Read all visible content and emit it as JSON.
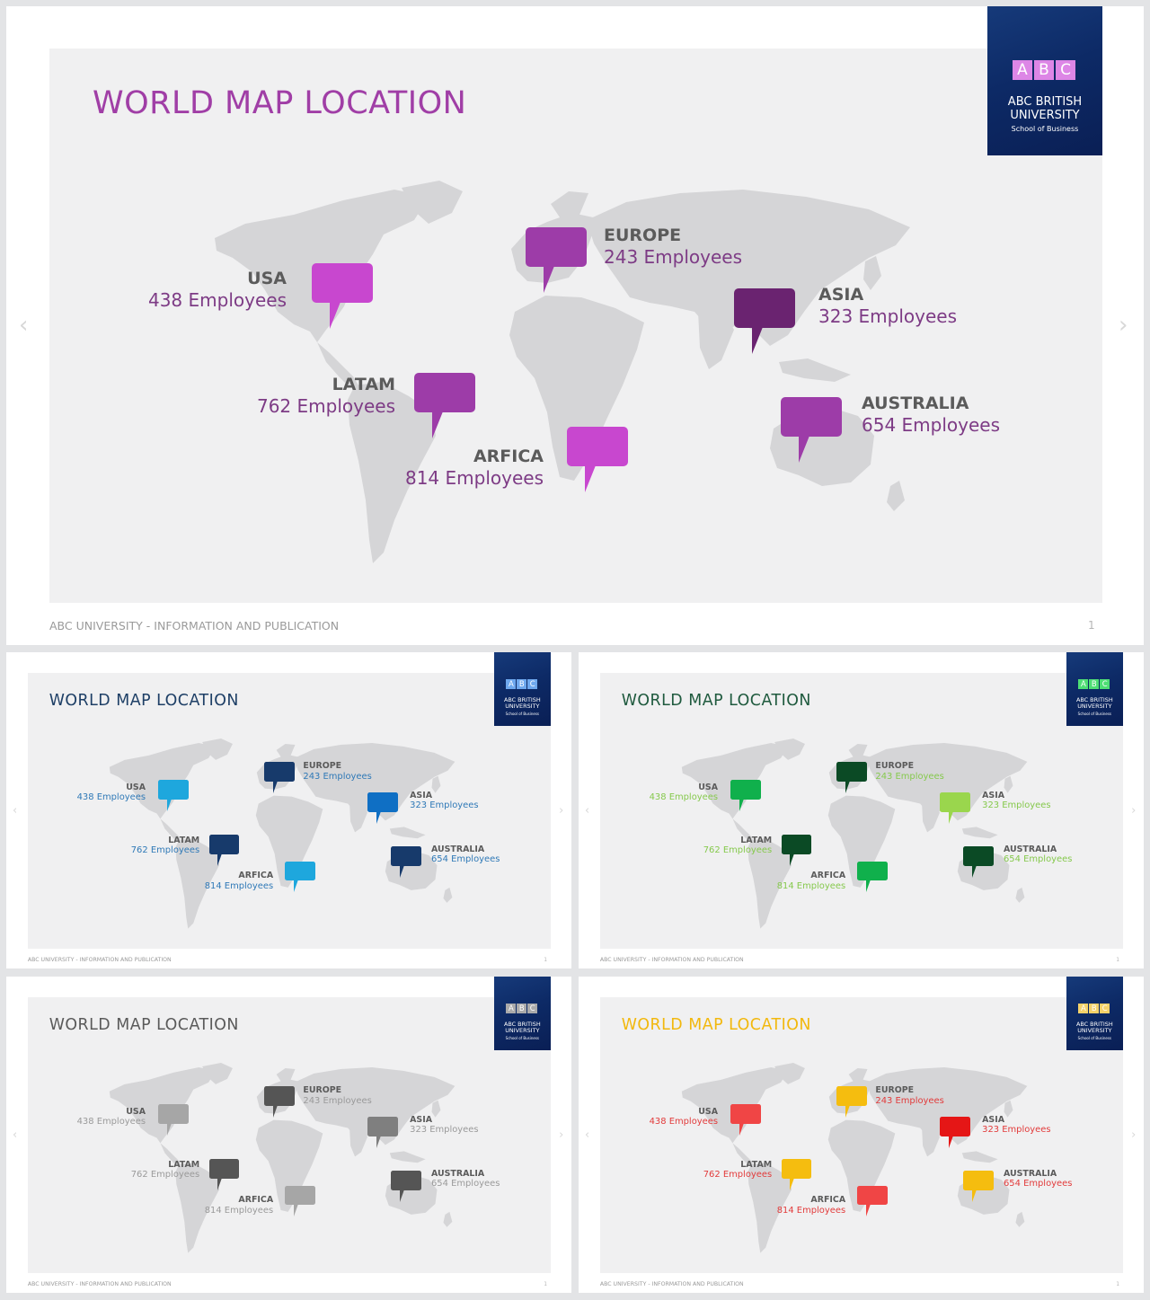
{
  "slides": [
    {
      "title": "WORLD MAP LOCATION",
      "footer": "ABC UNIVERSITY - INFORMATION AND PUBLICATION",
      "page": "1",
      "logo": {
        "letters": [
          "A",
          "B",
          "C"
        ],
        "name": "ABC BRITISH UNIVERSITY",
        "subtitle": "School of Business"
      },
      "colors": {
        "title": "#a03ea6",
        "text": "#7d3b85",
        "pin_light": "#c847cf",
        "pin_mid": "#9d3ca8",
        "pin_dark": "#6a2370",
        "tile": "#dd86e6"
      },
      "regions": [
        {
          "name": "USA",
          "count": "438 Employees",
          "tone": "light"
        },
        {
          "name": "EUROPE",
          "count": "243 Employees",
          "tone": "mid"
        },
        {
          "name": "ASIA",
          "count": "323 Employees",
          "tone": "dark"
        },
        {
          "name": "LATAM",
          "count": "762 Employees",
          "tone": "mid"
        },
        {
          "name": "ARFICA",
          "count": "814 Employees",
          "tone": "light"
        },
        {
          "name": "AUSTRALIA",
          "count": "654 Employees",
          "tone": "mid"
        }
      ]
    },
    {
      "title": "WORLD MAP LOCATION",
      "footer": "ABC UNIVERSITY - INFORMATION AND PUBLICATION",
      "page": "1",
      "logo": {
        "letters": [
          "A",
          "B",
          "C"
        ],
        "name": "ABC BRITISH UNIVERSITY",
        "subtitle": "School of Business"
      },
      "colors": {
        "title": "#1e3f66",
        "text": "#2f79b7",
        "pin_light": "#1ea7dd",
        "pin_mid": "#0f6fc4",
        "pin_dark": "#173a6b",
        "tile": "#6ea8ee"
      },
      "regions": [
        {
          "name": "USA",
          "count": "438 Employees",
          "tone": "light"
        },
        {
          "name": "EUROPE",
          "count": "243 Employees",
          "tone": "dark"
        },
        {
          "name": "ASIA",
          "count": "323 Employees",
          "tone": "mid"
        },
        {
          "name": "LATAM",
          "count": "762 Employees",
          "tone": "dark"
        },
        {
          "name": "ARFICA",
          "count": "814 Employees",
          "tone": "light"
        },
        {
          "name": "AUSTRALIA",
          "count": "654 Employees",
          "tone": "dark"
        }
      ]
    },
    {
      "title": "WORLD MAP LOCATION",
      "footer": "ABC UNIVERSITY - INFORMATION AND PUBLICATION",
      "page": "1",
      "logo": {
        "letters": [
          "A",
          "B",
          "C"
        ],
        "name": "ABC BRITISH UNIVERSITY",
        "subtitle": "School of Business"
      },
      "colors": {
        "title": "#1f5a3e",
        "text": "#86c94d",
        "pin_light": "#9ad64d",
        "pin_mid": "#10b04c",
        "pin_dark": "#0b4a25",
        "tile": "#4ede74"
      },
      "regions": [
        {
          "name": "USA",
          "count": "438 Employees",
          "tone": "mid"
        },
        {
          "name": "EUROPE",
          "count": "243 Employees",
          "tone": "dark"
        },
        {
          "name": "ASIA",
          "count": "323 Employees",
          "tone": "light"
        },
        {
          "name": "LATAM",
          "count": "762 Employees",
          "tone": "dark"
        },
        {
          "name": "ARFICA",
          "count": "814 Employees",
          "tone": "mid"
        },
        {
          "name": "AUSTRALIA",
          "count": "654 Employees",
          "tone": "dark"
        }
      ]
    },
    {
      "title": "WORLD MAP LOCATION",
      "footer": "ABC UNIVERSITY - INFORMATION AND PUBLICATION",
      "page": "1",
      "logo": {
        "letters": [
          "A",
          "B",
          "C"
        ],
        "name": "ABC BRITISH UNIVERSITY",
        "subtitle": "School of Business"
      },
      "colors": {
        "title": "#5a5a5a",
        "text": "#9a9a9a",
        "pin_light": "#a6a6a6",
        "pin_mid": "#7f7f7f",
        "pin_dark": "#555555",
        "tile": "#aaaaaa"
      },
      "regions": [
        {
          "name": "USA",
          "count": "438 Employees",
          "tone": "light"
        },
        {
          "name": "EUROPE",
          "count": "243 Employees",
          "tone": "dark"
        },
        {
          "name": "ASIA",
          "count": "323 Employees",
          "tone": "mid"
        },
        {
          "name": "LATAM",
          "count": "762 Employees",
          "tone": "dark"
        },
        {
          "name": "ARFICA",
          "count": "814 Employees",
          "tone": "light"
        },
        {
          "name": "AUSTRALIA",
          "count": "654 Employees",
          "tone": "dark"
        }
      ]
    },
    {
      "title": "WORLD MAP LOCATION",
      "footer": "ABC UNIVERSITY - INFORMATION AND PUBLICATION",
      "page": "1",
      "logo": {
        "letters": [
          "A",
          "B",
          "C"
        ],
        "name": "ABC BRITISH UNIVERSITY",
        "subtitle": "School of Business"
      },
      "colors": {
        "title": "#f2b80d",
        "text": "#e23b3b",
        "pin_light": "#f04545",
        "pin_mid": "#f5bd0f",
        "pin_dark": "#e51616",
        "tile": "#f5d26a"
      },
      "regions": [
        {
          "name": "USA",
          "count": "438 Employees",
          "tone": "light"
        },
        {
          "name": "EUROPE",
          "count": "243 Employees",
          "tone": "mid"
        },
        {
          "name": "ASIA",
          "count": "323 Employees",
          "tone": "dark"
        },
        {
          "name": "LATAM",
          "count": "762 Employees",
          "tone": "mid"
        },
        {
          "name": "ARFICA",
          "count": "814 Employees",
          "tone": "light"
        },
        {
          "name": "AUSTRALIA",
          "count": "654 Employees",
          "tone": "mid"
        }
      ]
    }
  ]
}
